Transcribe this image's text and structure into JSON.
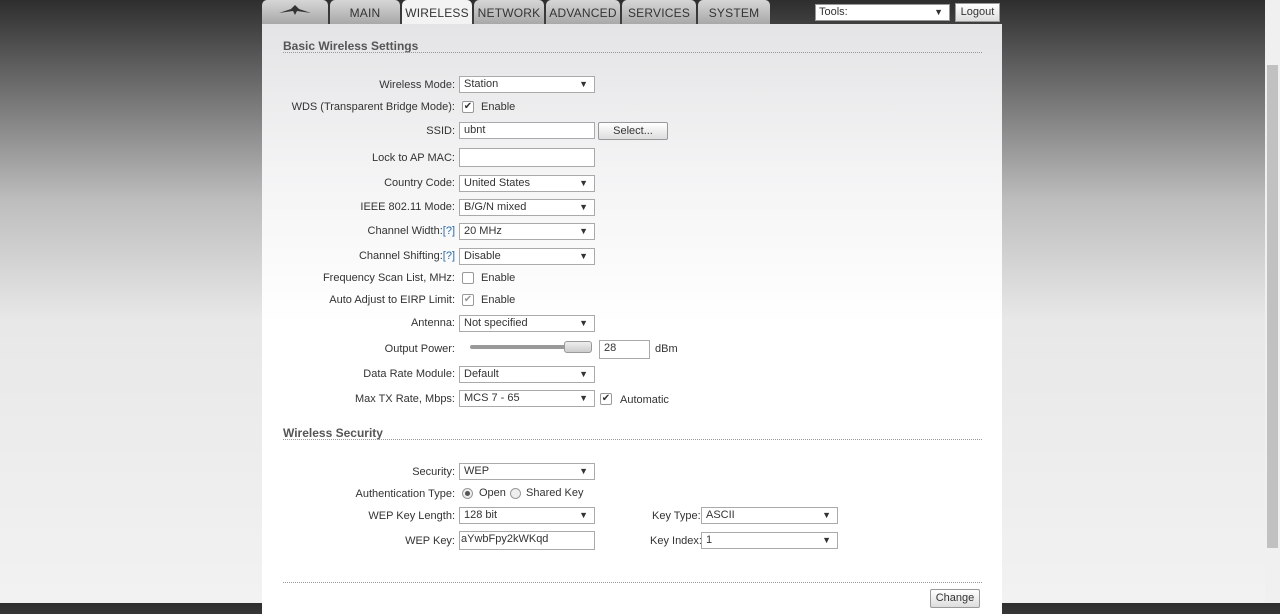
{
  "tabs": [
    {
      "label": "MAIN"
    },
    {
      "label": "WIRELESS"
    },
    {
      "label": "NETWORK"
    },
    {
      "label": "ADVANCED"
    },
    {
      "label": "SERVICES"
    },
    {
      "label": "SYSTEM"
    }
  ],
  "tools": {
    "value": "Tools:"
  },
  "logout": "Logout",
  "basic": {
    "title": "Basic Wireless Settings",
    "wireless_mode": {
      "label": "Wireless Mode:",
      "value": "Station"
    },
    "wds": {
      "label": "WDS (Transparent Bridge Mode):",
      "option": "Enable",
      "checked": true
    },
    "ssid": {
      "label": "SSID:",
      "value": "ubnt",
      "button": "Select..."
    },
    "lock_mac": {
      "label": "Lock to AP MAC:",
      "value": ""
    },
    "country": {
      "label": "Country Code:",
      "value": "United States"
    },
    "ieee": {
      "label": "IEEE 802.11 Mode:",
      "value": "B/G/N mixed"
    },
    "channel_width": {
      "label": "Channel Width:",
      "help": "[?]",
      "value": "20 MHz"
    },
    "channel_shifting": {
      "label": "Channel Shifting:",
      "help": "[?]",
      "value": "Disable"
    },
    "freq_scan": {
      "label": "Frequency Scan List, MHz:",
      "option": "Enable",
      "checked": false
    },
    "eirp": {
      "label": "Auto Adjust to EIRP Limit:",
      "option": "Enable",
      "checked": true
    },
    "antenna": {
      "label": "Antenna:",
      "value": "Not specified"
    },
    "output_power": {
      "label": "Output Power:",
      "value": "28",
      "unit": "dBm",
      "slider_fraction": 1.0
    },
    "data_rate": {
      "label": "Data Rate Module:",
      "value": "Default"
    },
    "max_tx": {
      "label": "Max TX Rate, Mbps:",
      "value": "MCS 7 - 65",
      "auto": "Automatic",
      "checked": true
    }
  },
  "security": {
    "title": "Wireless Security",
    "security": {
      "label": "Security:",
      "value": "WEP"
    },
    "auth": {
      "label": "Authentication Type:",
      "open": "Open",
      "shared": "Shared Key",
      "selected": "Open"
    },
    "key_length": {
      "label": "WEP Key Length:",
      "value": "128 bit"
    },
    "key_type": {
      "label": "Key Type:",
      "value": "ASCII"
    },
    "wep_key": {
      "label": "WEP Key:",
      "value": "aYwbFpy2kWKqd"
    },
    "key_index": {
      "label": "Key Index:",
      "value": "1"
    }
  },
  "change": "Change"
}
